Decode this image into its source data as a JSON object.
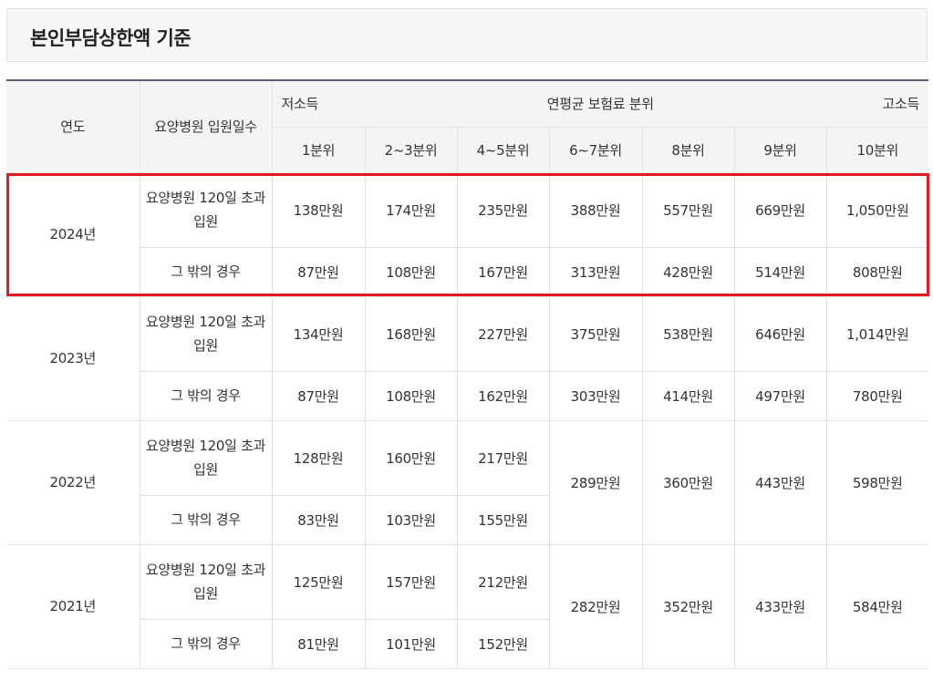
{
  "title": "본인부담상한액 기준",
  "header": {
    "year": "연도",
    "stay": "요양병원 입원일수",
    "low": "저소득",
    "mid": "연평균 보험료 분위",
    "high": "고소득",
    "deciles": [
      "1분위",
      "2~3분위",
      "4~5분위",
      "6~7분위",
      "8분위",
      "9분위",
      "10분위"
    ]
  },
  "stay_labels": {
    "over": "요양병원 120일 초과 입원",
    "other": "그 밖의 경우"
  },
  "years": [
    {
      "year": "2024년",
      "over": [
        "138만원",
        "174만원",
        "235만원",
        "388만원",
        "557만원",
        "669만원",
        "1,050만원"
      ],
      "other": [
        "87만원",
        "108만원",
        "167만원",
        "313만원",
        "428만원",
        "514만원",
        "808만원"
      ]
    },
    {
      "year": "2023년",
      "over": [
        "134만원",
        "168만원",
        "227만원",
        "375만원",
        "538만원",
        "646만원",
        "1,014만원"
      ],
      "other": [
        "87만원",
        "108만원",
        "162만원",
        "303만원",
        "414만원",
        "497만원",
        "780만원"
      ]
    },
    {
      "year": "2022년",
      "over": [
        "128만원",
        "160만원",
        "217만원"
      ],
      "other": [
        "83만원",
        "103만원",
        "155만원"
      ],
      "shared": [
        "289만원",
        "360만원",
        "443만원",
        "598만원"
      ]
    },
    {
      "year": "2021년",
      "over": [
        "125만원",
        "157만원",
        "212만원"
      ],
      "other": [
        "81만원",
        "101만원",
        "152만원"
      ],
      "shared": [
        "282만원",
        "352만원",
        "433만원",
        "584만원"
      ]
    }
  ]
}
